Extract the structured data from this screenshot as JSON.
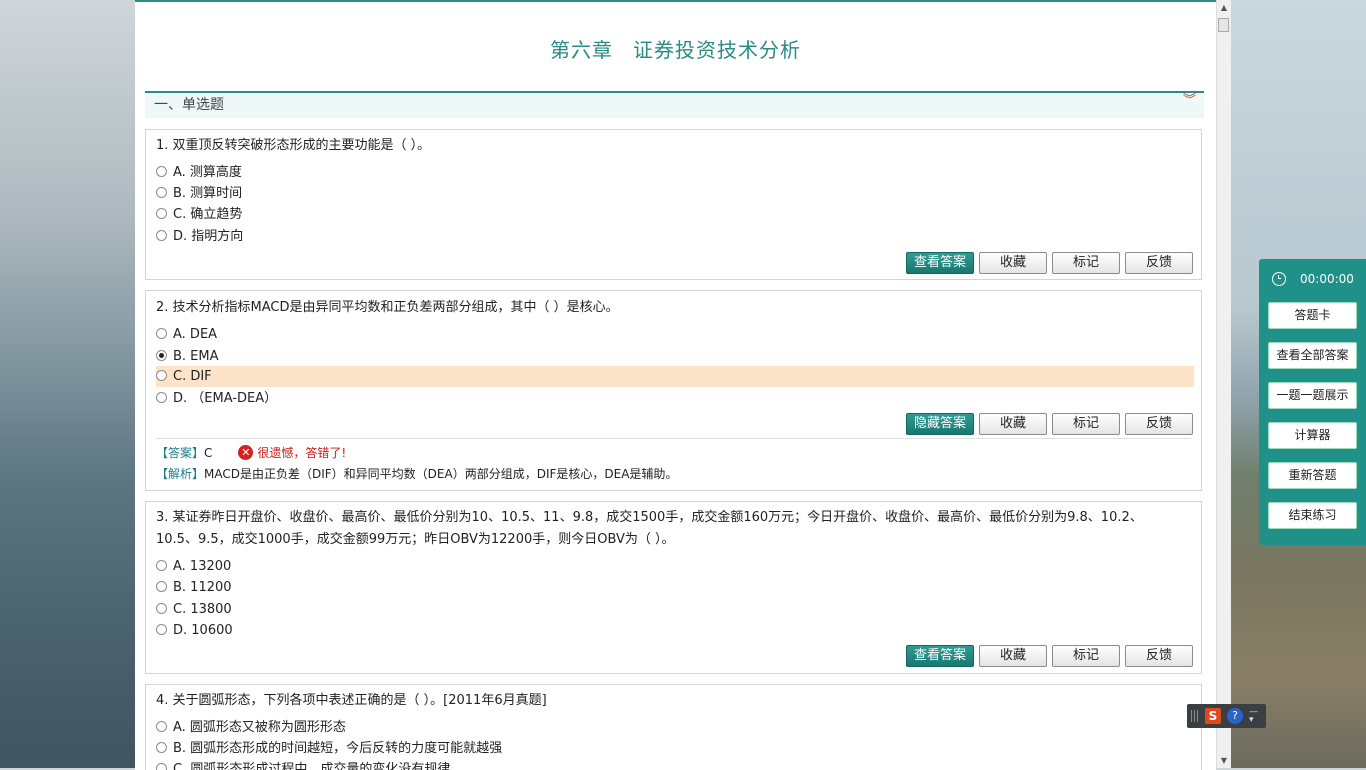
{
  "title": {
    "chapter": "第六章",
    "name": "证券投资技术分析"
  },
  "section": {
    "label": "一、单选题"
  },
  "questions": [
    {
      "stem": "1. 双重顶反转突破形态形成的主要功能是（    ）。",
      "options": [
        "A. 测算高度",
        "B. 测算时间",
        "C. 确立趋势",
        "D. 指明方向"
      ],
      "buttons": [
        "查看答案",
        "收藏",
        "标记",
        "反馈"
      ]
    },
    {
      "stem": "2. 技术分析指标MACD是由异同平均数和正负差两部分组成，其中（    ）是核心。",
      "options": [
        "A. DEA",
        "B. EMA",
        "C. DIF",
        "D. （EMA-DEA）"
      ],
      "selected": "B",
      "highlighted": "C",
      "buttons": [
        "隐藏答案",
        "收藏",
        "标记",
        "反馈"
      ],
      "answer_tag": "【答案】",
      "answer": "C",
      "result": "很遗憾，答错了!",
      "analysis_tag": "【解析】",
      "analysis": "MACD是由正负差（DIF）和异同平均数（DEA）两部分组成，DIF是核心，DEA是辅助。"
    },
    {
      "stem_line1": "3. 某证券昨日开盘价、收盘价、最高价、最低价分别为10、10.5、11、9.8，成交1500手，成交金额160万元；今日开盘价、收盘价、最高价、最低价分别为9.8、10.2、",
      "stem_line2": "10.5、9.5，成交1000手，成交金额99万元；昨日OBV为12200手，则今日OBV为（    ）。",
      "options": [
        "A. 13200",
        "B. 11200",
        "C. 13800",
        "D. 10600"
      ],
      "buttons": [
        "查看答案",
        "收藏",
        "标记",
        "反馈"
      ]
    },
    {
      "stem": "4. 关于圆弧形态，下列各项中表述正确的是（    ）。[2011年6月真题]",
      "options": [
        "A. 圆弧形态又被称为圆形形态",
        "B. 圆弧形态形成的时间越短，今后反转的力度可能就越强",
        "C. 圆弧形态形成过程中，成交量的变化没有规律"
      ]
    }
  ],
  "panel": {
    "timer": "00:00:00",
    "buttons": [
      "答题卡",
      "查看全部答案",
      "一题一题展示",
      "计算器",
      "重新答题",
      "结束练习"
    ]
  },
  "ime": {
    "s": "S",
    "help": "?"
  },
  "icons": [
    "clock-icon",
    "collapse-icon",
    "wrong-icon",
    "radio-icon"
  ],
  "colors": {
    "accent": "#1f9188",
    "highlight": "#fde3c8",
    "error": "#cc1a1a"
  }
}
